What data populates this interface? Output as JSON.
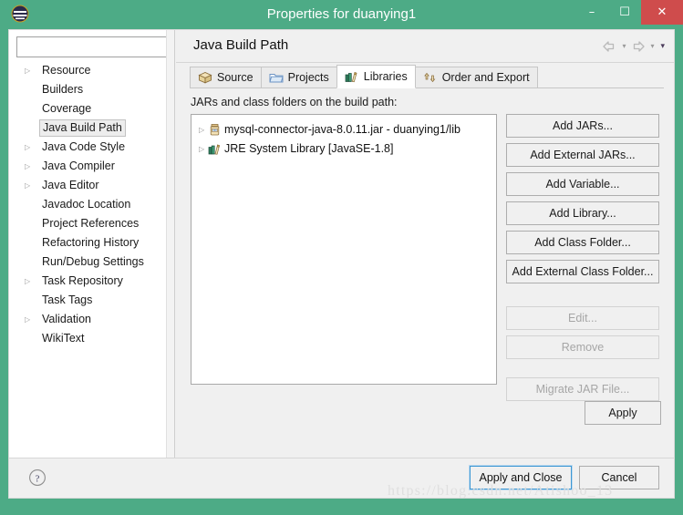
{
  "window": {
    "title": "Properties for duanying1",
    "app_icon": "eclipse-icon",
    "accent_color": "#4dab86",
    "close_color": "#cf4c4c",
    "minimize_label": "–",
    "maximize_label": "☐",
    "close_label": "✕"
  },
  "sidebar": {
    "filter_value": "",
    "filter_placeholder": "",
    "items": [
      {
        "label": "Resource",
        "expandable": true,
        "selected": false
      },
      {
        "label": "Builders",
        "expandable": false,
        "selected": false
      },
      {
        "label": "Coverage",
        "expandable": false,
        "selected": false
      },
      {
        "label": "Java Build Path",
        "expandable": false,
        "selected": true
      },
      {
        "label": "Java Code Style",
        "expandable": true,
        "selected": false
      },
      {
        "label": "Java Compiler",
        "expandable": true,
        "selected": false
      },
      {
        "label": "Java Editor",
        "expandable": true,
        "selected": false
      },
      {
        "label": "Javadoc Location",
        "expandable": false,
        "selected": false
      },
      {
        "label": "Project References",
        "expandable": false,
        "selected": false
      },
      {
        "label": "Refactoring History",
        "expandable": false,
        "selected": false
      },
      {
        "label": "Run/Debug Settings",
        "expandable": false,
        "selected": false
      },
      {
        "label": "Task Repository",
        "expandable": true,
        "selected": false
      },
      {
        "label": "Task Tags",
        "expandable": false,
        "selected": false
      },
      {
        "label": "Validation",
        "expandable": true,
        "selected": false
      },
      {
        "label": "WikiText",
        "expandable": false,
        "selected": false
      }
    ]
  },
  "content": {
    "page_title": "Java Build Path",
    "nav": {
      "back_icon": "back-arrow-icon",
      "back_caret": "▾",
      "forward_icon": "forward-arrow-icon",
      "forward_caret": "▾",
      "menu_caret": "▾"
    },
    "tabs": [
      {
        "label": "Source",
        "icon": "package-icon",
        "active": false
      },
      {
        "label": "Projects",
        "icon": "folder-icon",
        "active": false
      },
      {
        "label": "Libraries",
        "icon": "books-icon",
        "active": true
      },
      {
        "label": "Order and Export",
        "icon": "order-arrows-icon",
        "active": false
      }
    ],
    "list_label": "JARs and class folders on the build path:",
    "entries": [
      {
        "label": "mysql-connector-java-8.0.11.jar - duanying1/lib",
        "icon": "jar-icon",
        "expandable": true
      },
      {
        "label": "JRE System Library [JavaSE-1.8]",
        "icon": "library-icon",
        "expandable": true
      }
    ],
    "actions": [
      {
        "label": "Add JARs...",
        "enabled": true
      },
      {
        "label": "Add External JARs...",
        "enabled": true
      },
      {
        "label": "Add Variable...",
        "enabled": true
      },
      {
        "label": "Add Library...",
        "enabled": true
      },
      {
        "label": "Add Class Folder...",
        "enabled": true
      },
      {
        "label": "Add External Class Folder...",
        "enabled": true
      },
      {
        "label": "Edit...",
        "enabled": false
      },
      {
        "label": "Remove",
        "enabled": false
      },
      {
        "label": "Migrate JAR File...",
        "enabled": false
      }
    ],
    "apply_label": "Apply"
  },
  "footer": {
    "help_icon": "help-icon",
    "help_glyph": "?",
    "apply_and_close_label": "Apply and Close",
    "cancel_label": "Cancel"
  },
  "watermark": {
    "text": "https://blog.csdn.net/Atishoo_13"
  }
}
